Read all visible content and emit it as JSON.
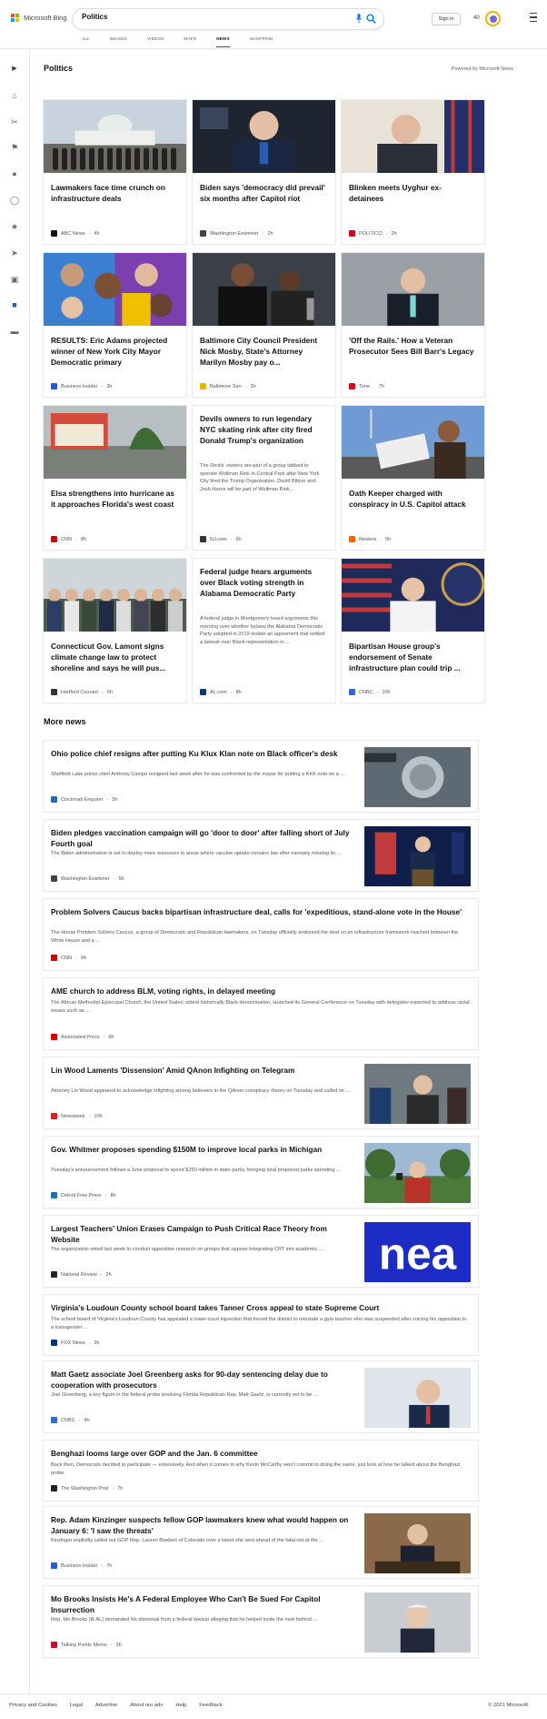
{
  "header": {
    "brand": "Microsoft Bing",
    "search_value": "Politics",
    "signin_label": "Sign in",
    "points": "40",
    "tabs": [
      {
        "label": "ALL"
      },
      {
        "label": "IMAGES"
      },
      {
        "label": "VIDEOS"
      },
      {
        "label": "MAPS"
      },
      {
        "label": "NEWS",
        "active": true
      },
      {
        "label": "SHOPPING"
      }
    ]
  },
  "sidebar": {
    "icons": [
      "expand-icon",
      "home-icon",
      "scissors-icon",
      "flag-icon",
      "location-icon",
      "globe-icon",
      "trophy-icon",
      "rocket-icon",
      "video-icon",
      "politics-icon",
      "card-icon"
    ]
  },
  "politics": {
    "title": "Politics",
    "powered_by": "Powered by Microsoft News",
    "cards": [
      {
        "title": "Lawmakers face time crunch on infrastructure deals",
        "source": "ABC News",
        "age": "4h",
        "favicon_color": "#111111"
      },
      {
        "title": "Biden says 'democracy did prevail' six months after Capitol riot",
        "source": "Washington Examiner",
        "age": "2h",
        "favicon_color": "#444444"
      },
      {
        "title": "Blinken meets Uyghur ex-detainees",
        "source": "POLITICO",
        "age": "2h",
        "favicon_color": "#d6001c"
      },
      {
        "title": "RESULTS: Eric Adams projected winner of New York City Mayor Democratic primary",
        "source": "Business Insider",
        "age": "3h",
        "favicon_color": "#1f5cd6"
      },
      {
        "title": "Baltimore City Council President Nick Mosby, State's Attorney Marilyn Mosby pay o...",
        "source": "Baltimore Sun",
        "age": "3h",
        "favicon_color": "#e8b400"
      },
      {
        "title": "'Off the Rails.' How a Veteran Prosecutor Sees Bill Barr's Legacy",
        "source": "Time",
        "age": "7h",
        "favicon_color": "#e30613"
      },
      {
        "title": "Elsa strengthens into hurricane as it approaches Florida's west coast",
        "source": "CNN",
        "age": "8h",
        "favicon_color": "#cc0000"
      },
      {
        "title": "Devils owners to run legendary NYC skating rink after city fired Donald Trump's organization",
        "snippet": "The Devils' owners are part of a group tabbed to operate Wollman Rink in Central Park after New York City fired the Trump Organization. David Blitzer and Josh Harris will be part of Wollman Rink ...",
        "source": "NJ.com",
        "age": "6h",
        "favicon_color": "#333333"
      },
      {
        "title": "Oath Keeper charged with conspiracy in U.S. Capitol attack",
        "source": "Reuters",
        "age": "5h",
        "favicon_color": "#fa6400"
      },
      {
        "title": "Connecticut Gov. Lamont signs climate change law to protect shoreline and says he will pus...",
        "source": "Hartford Courant",
        "age": "6h",
        "favicon_color": "#333333"
      },
      {
        "title": "Federal judge hears arguments over Black voting strength in Alabama Democratic Party",
        "snippet": "A federal judge in Montgomery heard arguments this morning over whether bylaws the Alabama Democratic Party adopted in 2019 violate an agreement that settled a lawsuit over Black representation in ...",
        "source": "AL.com",
        "age": "8h",
        "favicon_color": "#0a3a6b"
      },
      {
        "title": "Bipartisan House group's endorsement of Senate infrastructure plan could trip ...",
        "source": "CNBC",
        "age": "10h",
        "favicon_color": "#2b6bd6"
      }
    ]
  },
  "more_news": {
    "title": "More news",
    "items": [
      {
        "title": "Ohio police chief resigns after putting Ku Klux Klan note on Black officer's desk",
        "snippet": "Sheffield Lake police chief Anthony Campo resigned last week after he was confronted by the mayor for putting a KKK note on a ...",
        "source": "Cincinnati Enquirer",
        "age": "5h",
        "favicon_color": "#1b6fb5"
      },
      {
        "title": "Biden pledges vaccination campaign will go 'door to door' after falling short of July Fourth goal",
        "snippet": "The Biden administration is set to deploy more resources to areas where vaccine uptake remains low after narrowly missing its ...",
        "source": "Washington Examiner",
        "age": "5h",
        "favicon_color": "#444444"
      },
      {
        "title": "Problem Solvers Caucus backs bipartisan infrastructure deal, calls for 'expeditious, stand-alone vote in the House'",
        "snippet": "The House Problem Solvers Caucus, a group of Democratic and Republican lawmakers, on Tuesday officially endorsed the deal on an infrastructure framework reached between the White House and a ...",
        "source": "CNN",
        "age": "9h",
        "favicon_color": "#cc0000"
      },
      {
        "title": "AME church to address BLM, voting rights, in delayed meeting",
        "snippet": "The African Methodist Episcopal Church, the United States' oldest historically Black denomination, launched its General Conference on Tuesday with delegates expected to address racial issues such as ...",
        "source": "Associated Press",
        "age": "9h",
        "favicon_color": "#cc0000"
      },
      {
        "title": "Lin Wood Laments 'Dissension' Amid QAnon Infighting on Telegram",
        "snippet": "Attorney Lin Wood appeared to acknowledge infighting among believers in the QAnon conspiracy theory on Tuesday and called on ...",
        "source": "Newsweek",
        "age": "10h",
        "favicon_color": "#e11b22"
      },
      {
        "title": "Gov. Whitmer proposes spending $150M to improve local parks in Michigan",
        "snippet": "Tuesday's announcement follows a June proposal to spend $250 million in state parks, bringing total proposed parks spending ...",
        "source": "Detroit Free Press",
        "age": "8h",
        "favicon_color": "#1b6fb5"
      },
      {
        "title": "Largest Teachers' Union Erases Campaign to Push Critical Race Theory from Website",
        "snippet": "The organization voted last week to conduct opposition research on groups that oppose integrating CRT into academic ...",
        "source": "National Review",
        "age": "2h",
        "favicon_color": "#222222"
      },
      {
        "title": "Virginia's Loudoun County school board takes Tanner Cross appeal to state Supreme Court",
        "snippet": "The school board of Virginia's Loudoun County has appealed a lower-court injunction that forced the district to reinstate a gym teacher who was suspended after voicing his opposition to a transgender ...",
        "source": "FOX News",
        "age": "3h",
        "favicon_color": "#003366"
      },
      {
        "title": "Matt Gaetz associate Joel Greenberg asks for 90-day sentencing delay due to cooperation with prosecutors",
        "snippet": "Joel Greenberg, a key figure in the federal probe involving Florida Republican Rep. Matt Gaetz, is currently set to be ...",
        "source": "CNBC",
        "age": "4h",
        "favicon_color": "#2b6bd6"
      },
      {
        "title": "Benghazi looms large over GOP and the Jan. 6 committee",
        "snippet": "Back then, Democrats decided to participate — extensively. And when it comes to why Kevin McCarthy won't commit to doing the same, just look at how he talked about the Benghazi probe.",
        "source": "The Washington Post",
        "age": "7h",
        "favicon_color": "#222222"
      },
      {
        "title": "Rep. Adam Kinzinger suspects fellow GOP lawmakers knew what would happen on January 6: 'I saw the threats'",
        "snippet": "Kinzinger explicitly called out GOP Rep. Lauren Boebert of Colorado over a tweet she sent ahead of the fatal riot at the ...",
        "source": "Business Insider",
        "age": "7h",
        "favicon_color": "#1f5cd6"
      },
      {
        "title": "Mo Brooks Insists He's A Federal Employee Who Can't Be Sued For Capitol Insurrection",
        "snippet": "Rep. Mo Brooks (R-AL) demanded his dismissal from a federal lawsuit alleging that he helped incite the mob behind ...",
        "source": "Talking Points Memo",
        "age": "3h",
        "favicon_color": "#c0102e"
      }
    ]
  },
  "footer": {
    "links": [
      "Privacy and Cookies",
      "Legal",
      "Advertise",
      "About our ads",
      "Help",
      "Feedback"
    ],
    "copyright": "© 2021 Microsoft"
  },
  "colors": {
    "accent": "#174ae4",
    "text": "#111111",
    "muted": "#555555"
  }
}
